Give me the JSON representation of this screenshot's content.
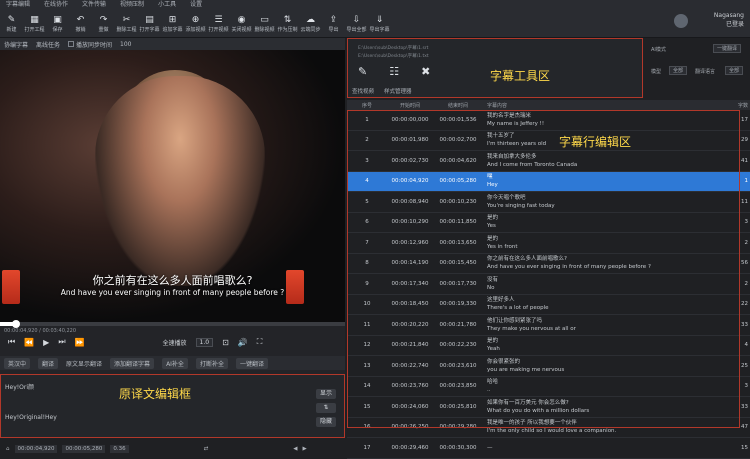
{
  "app": {
    "title": "字幕编辑"
  },
  "menu": [
    "字幕编辑",
    "在线协作",
    "文件传输",
    "视频压制",
    "小工具",
    "设置"
  ],
  "toolbar": [
    {
      "icon": "✎",
      "label": "新建"
    },
    {
      "icon": "▦",
      "label": "打开工程"
    },
    {
      "icon": "▣",
      "label": "保存"
    },
    {
      "icon": "↶",
      "label": "撤销"
    },
    {
      "icon": "↷",
      "label": "重做"
    },
    {
      "icon": "✂",
      "label": "删除工程"
    },
    {
      "icon": "▤",
      "label": "打开字幕"
    },
    {
      "icon": "⊞",
      "label": "追加字幕"
    },
    {
      "icon": "⊕",
      "label": "添加视频"
    },
    {
      "icon": "☰",
      "label": "打开视频"
    },
    {
      "icon": "◉",
      "label": "关闭视频"
    },
    {
      "icon": "▭",
      "label": "删除视频"
    },
    {
      "icon": "⇅",
      "label": "作为压制"
    },
    {
      "icon": "☁",
      "label": "云端同步"
    },
    {
      "icon": "⇪",
      "label": "导出"
    },
    {
      "icon": "⇩",
      "label": "导出全部"
    },
    {
      "icon": "⇓",
      "label": "导出字幕"
    }
  ],
  "user": {
    "name": "Nagasang",
    "status": "已登录"
  },
  "video_tabs": {
    "tab1": "协编字幕",
    "tab2": "离线任务",
    "checkbox": "播放同步时间",
    "value": "100"
  },
  "video": {
    "subtitle_cn": "你之前有在这么多人面前唱歌么?",
    "subtitle_en": "And have you ever singing in front of many people before ?",
    "time": "00:00:04,920 / 00:03:40,220"
  },
  "controls": {
    "speed_label": "全速播放",
    "speed_value": "1.0"
  },
  "optbar": {
    "mode": "英汉中",
    "btn1": "翻译",
    "checkbox": "原文显示翻译",
    "btn2": "添加翻译字幕",
    "btn3": "AI补全",
    "btn4": "打断补全",
    "btn5": "一键翻译"
  },
  "editor": {
    "line1": "Hey!Ori颜",
    "line2": "Hey!Original!Hey",
    "label": "原译文编辑框",
    "btn_top": "显示",
    "btn_bottom": "隐藏"
  },
  "bottombar": {
    "start": "00:00:04,920",
    "end": "00:00:05,280",
    "dur": "0.36"
  },
  "tools": {
    "path1": "E:\\Users\\sub\\Desktop\\字幕\\1.srt",
    "path2": "E:\\Users\\sub\\Desktop\\字幕\\1.txt",
    "label": "字幕工具区",
    "tab1": "查找视频",
    "tab2": "样式管理器"
  },
  "rcontrols": {
    "label1": "AI模式",
    "label2": "模型",
    "sel1": "全部",
    "label3": "翻译语言",
    "sel2": "全部",
    "btn": "一键翻译"
  },
  "table": {
    "headers": [
      "序号",
      "开始时间",
      "结束时间",
      "字幕内容",
      "字数"
    ],
    "label": "字幕行编辑区",
    "rows": [
      {
        "n": "1",
        "start": "00:00:00,000",
        "end": "00:00:01,536",
        "text": "我的名字是杰瑞米 / My name is Jeffery !!",
        "c": "17"
      },
      {
        "n": "2",
        "start": "00:00:01,980",
        "end": "00:00:02,700",
        "text": "我十五岁了 / I'm thirteen years old",
        "c": "29"
      },
      {
        "n": "3",
        "start": "00:00:02,730",
        "end": "00:00:04,620",
        "text": "我来自加拿大多伦多 / And I come from Toronto Canada",
        "c": "41"
      },
      {
        "n": "4",
        "start": "00:00:04,920",
        "end": "00:00:05,280",
        "text": "嘿 / Hey",
        "c": "1"
      },
      {
        "n": "5",
        "start": "00:00:08,940",
        "end": "00:00:10,230",
        "text": "你今天唱个歌吧 / You're singing fast today",
        "c": "11"
      },
      {
        "n": "6",
        "start": "00:00:10,290",
        "end": "00:00:11,850",
        "text": "是的 / Yes",
        "c": "3"
      },
      {
        "n": "7",
        "start": "00:00:12,960",
        "end": "00:00:13,650",
        "text": "是的 / Yes in front",
        "c": "2"
      },
      {
        "n": "8",
        "start": "00:00:14,190",
        "end": "00:00:15,450",
        "text": "你之前有在这么多人面前唱歌么? / And have you ever singing in front of many people before ?",
        "c": "56"
      },
      {
        "n": "9",
        "start": "00:00:17,340",
        "end": "00:00:17,730",
        "text": "没有 / No",
        "c": "2"
      },
      {
        "n": "10",
        "start": "00:00:18,450",
        "end": "00:00:19,330",
        "text": "这里好多人 / There's a lot of people",
        "c": "22"
      },
      {
        "n": "11",
        "start": "00:00:20,220",
        "end": "00:00:21,780",
        "text": "他们让你感到紧张了吗 / They make you nervous at all or",
        "c": "33"
      },
      {
        "n": "12",
        "start": "00:00:21,840",
        "end": "00:00:22,230",
        "text": "是的 / Yeah",
        "c": "4"
      },
      {
        "n": "13",
        "start": "00:00:22,740",
        "end": "00:00:23,610",
        "text": "你会很紧张的 / you are making me nervous",
        "c": "25"
      },
      {
        "n": "14",
        "start": "00:00:23,760",
        "end": "00:00:23,850",
        "text": "哈哈 / ..",
        "c": "3"
      },
      {
        "n": "15",
        "start": "00:00:24,060",
        "end": "00:00:25,810",
        "text": "如果你有一百万美元 你会怎么做? / What do you do with a million dollars",
        "c": "33"
      },
      {
        "n": "16",
        "start": "00:00:26,250",
        "text": "我是唯一的孩子 所以我想要一个伙伴 / I'm the only child so I would love a companion.",
        "end": "00:00:29,280",
        "c": "47"
      },
      {
        "n": "17",
        "start": "00:00:29,460",
        "end": "00:00:30,300",
        "text": "—",
        "c": "15"
      }
    ]
  }
}
